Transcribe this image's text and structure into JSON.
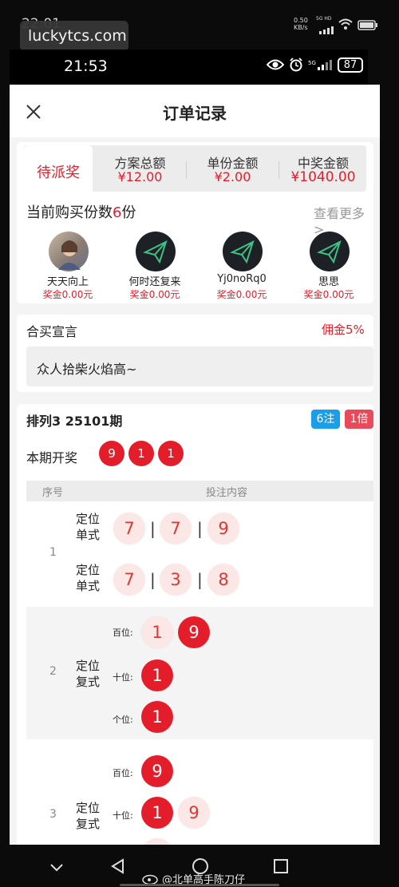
{
  "outer_status": {
    "time": "22:01",
    "speed": "0.50\nKB/s",
    "net": "5G HD"
  },
  "watermark": "luckytcs.com",
  "inner_status": {
    "time": "21:53",
    "battery": "87"
  },
  "header": {
    "title": "订单记录"
  },
  "tabs": {
    "active": "待派奖",
    "items": [
      {
        "label": "方案总额",
        "value": "¥12.00"
      },
      {
        "label": "单份金额",
        "value": "¥2.00"
      },
      {
        "label": "中奖金额",
        "value": "¥1040.00"
      }
    ]
  },
  "buyers": {
    "title_prefix": "当前购买份数",
    "count": "6",
    "title_suffix": "份",
    "more": "查看更多>",
    "items": [
      {
        "name": "天天向上",
        "prize": "奖金0.00元"
      },
      {
        "name": "何时还复来",
        "prize": "奖金0.00元"
      },
      {
        "name": "Yj0noRq0",
        "prize": "奖金0.00元"
      },
      {
        "name": "思思",
        "prize": "奖金0.00元"
      }
    ]
  },
  "declaration": {
    "title": "合买宣言",
    "commission": "佣金5%",
    "text": "众人拾柴火焰高~"
  },
  "bet": {
    "title": "排列3 25101期",
    "notes": "6注",
    "multiple": "1倍",
    "draw_label": "本期开奖",
    "draw_numbers": [
      "9",
      "1",
      "1"
    ],
    "col_index": "序号",
    "col_content": "投注内容",
    "rows": [
      {
        "index": "1",
        "type": "定位\n单式",
        "lines": [
          [
            "7",
            "7",
            "9"
          ],
          [
            "7",
            "3",
            "8"
          ]
        ]
      },
      {
        "index": "2",
        "type": "定位\n复式",
        "positions": [
          {
            "label": "百位:",
            "numbers": [
              "1",
              "9"
            ]
          },
          {
            "label": "十位:",
            "numbers": [
              "1"
            ]
          },
          {
            "label": "个位:",
            "numbers": [
              "1"
            ]
          }
        ]
      },
      {
        "index": "3",
        "type": "定位\n复式",
        "positions": [
          {
            "label": "百位:",
            "numbers": [
              "9"
            ]
          },
          {
            "label": "十位:",
            "numbers": [
              "1",
              "9"
            ]
          }
        ]
      }
    ]
  },
  "weibo_tag": "@北单高手陈刀仔",
  "colors": {
    "accent_red": "#e31e2a",
    "badge_blue": "#1b9ee8",
    "win_red": "#d73a35"
  }
}
